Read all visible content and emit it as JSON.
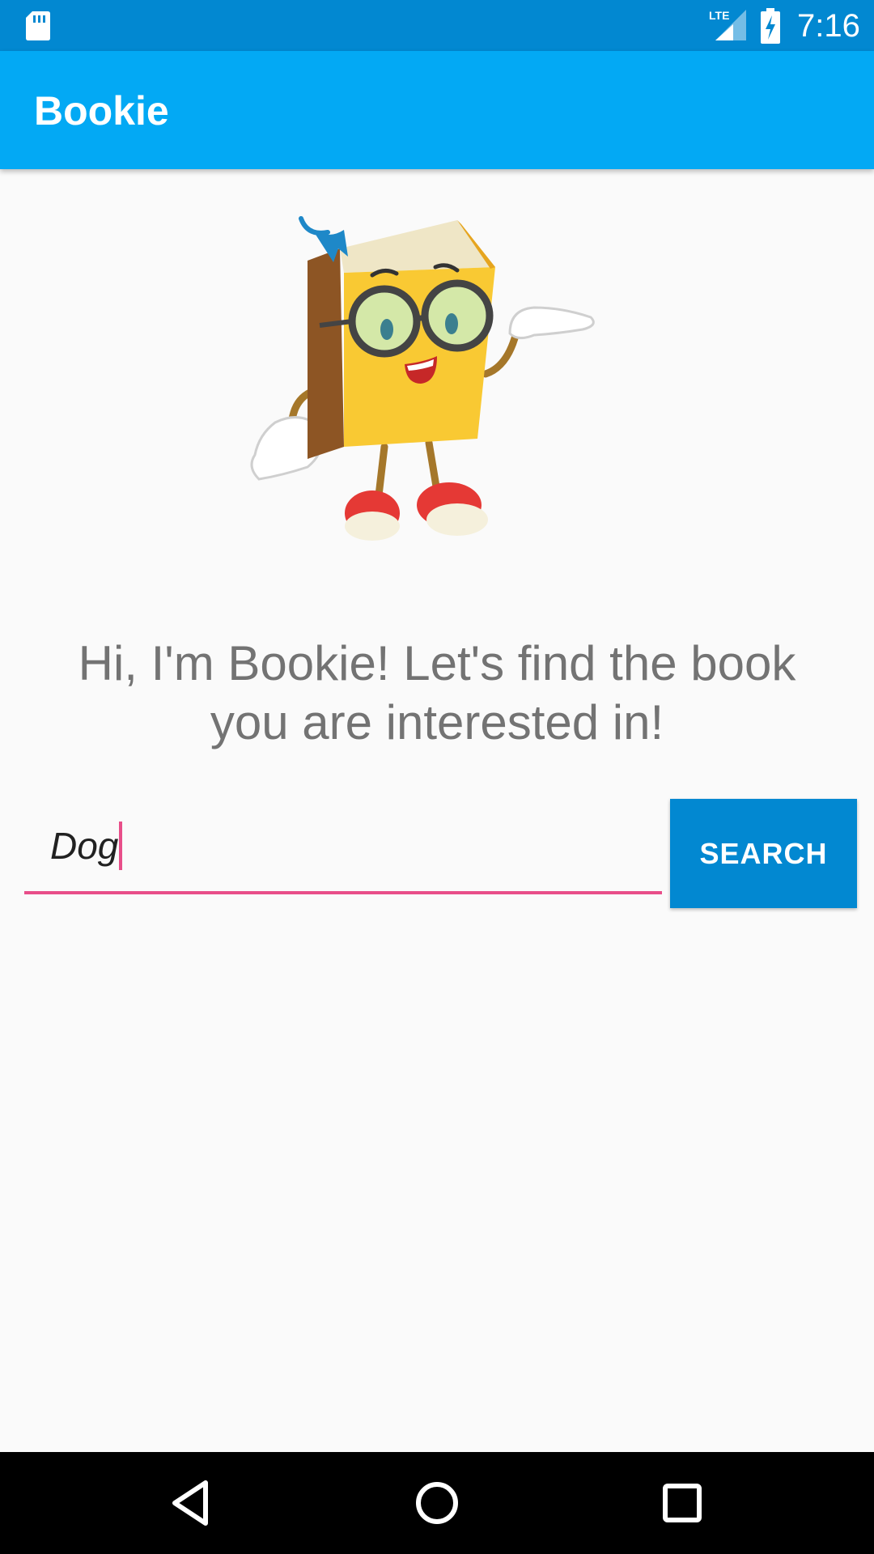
{
  "status_bar": {
    "time": "7:16",
    "network_label": "LTE",
    "icons": [
      "sd-card-icon",
      "lte-signal-icon",
      "battery-charging-icon"
    ]
  },
  "app_bar": {
    "title": "Bookie"
  },
  "main": {
    "mascot_icon": "bookie-mascot-icon",
    "welcome_line1": "Hi, I'm Bookie! Let's find the book",
    "welcome_line2": "you are interested in!",
    "search_input_value": "Dog",
    "search_button_label": "SEARCH"
  },
  "nav_bar": {
    "icons": [
      "back-icon",
      "home-icon",
      "recents-icon"
    ]
  },
  "colors": {
    "status_bar": "#0288d1",
    "app_bar": "#03a9f4",
    "accent": "#e84e89",
    "button": "#0288d1",
    "background": "#fafafa",
    "text_secondary": "#737373"
  }
}
